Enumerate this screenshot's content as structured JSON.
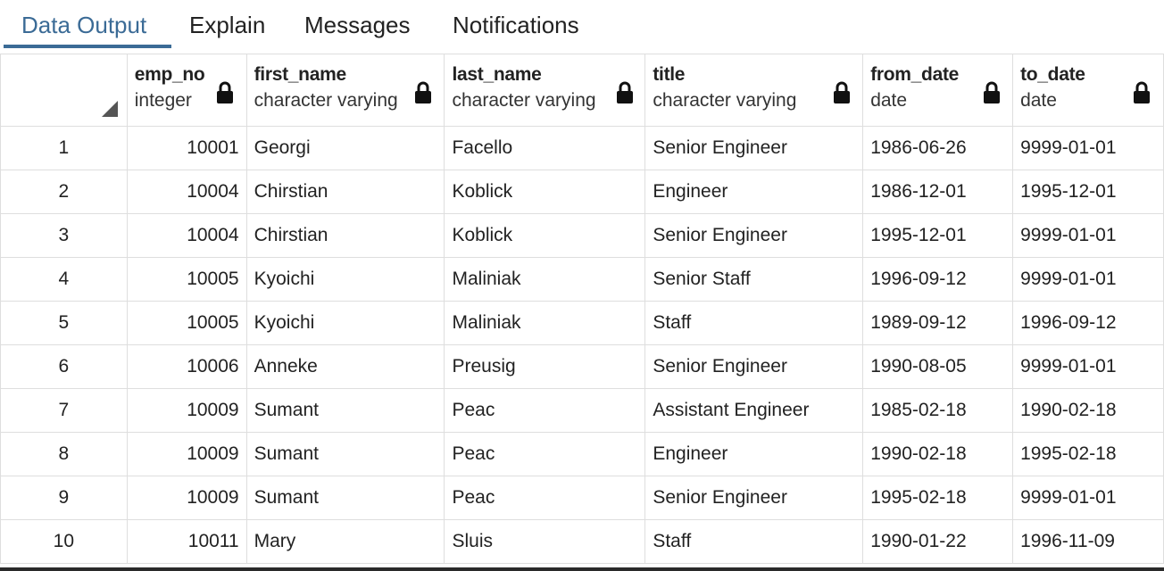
{
  "tabs": [
    {
      "label": "Data Output",
      "active": true
    },
    {
      "label": "Explain",
      "active": false
    },
    {
      "label": "Messages",
      "active": false
    },
    {
      "label": "Notifications",
      "active": false
    }
  ],
  "grid": {
    "columns": [
      {
        "name": "emp_no",
        "type": "integer",
        "icon": "lock-icon"
      },
      {
        "name": "first_name",
        "type": "character varying",
        "icon": "lock-icon"
      },
      {
        "name": "last_name",
        "type": "character varying",
        "icon": "lock-icon"
      },
      {
        "name": "title",
        "type": "character varying",
        "icon": "lock-icon"
      },
      {
        "name": "from_date",
        "type": "date",
        "icon": "lock-icon"
      },
      {
        "name": "to_date",
        "type": "date",
        "icon": "lock-icon"
      }
    ],
    "rows": [
      [
        "1",
        "10001",
        "Georgi",
        "Facello",
        "Senior Engineer",
        "1986-06-26",
        "9999-01-01"
      ],
      [
        "2",
        "10004",
        "Chirstian",
        "Koblick",
        "Engineer",
        "1986-12-01",
        "1995-12-01"
      ],
      [
        "3",
        "10004",
        "Chirstian",
        "Koblick",
        "Senior Engineer",
        "1995-12-01",
        "9999-01-01"
      ],
      [
        "4",
        "10005",
        "Kyoichi",
        "Maliniak",
        "Senior Staff",
        "1996-09-12",
        "9999-01-01"
      ],
      [
        "5",
        "10005",
        "Kyoichi",
        "Maliniak",
        "Staff",
        "1989-09-12",
        "1996-09-12"
      ],
      [
        "6",
        "10006",
        "Anneke",
        "Preusig",
        "Senior Engineer",
        "1990-08-05",
        "9999-01-01"
      ],
      [
        "7",
        "10009",
        "Sumant",
        "Peac",
        "Assistant Engineer",
        "1985-02-18",
        "1990-02-18"
      ],
      [
        "8",
        "10009",
        "Sumant",
        "Peac",
        "Engineer",
        "1990-02-18",
        "1995-02-18"
      ],
      [
        "9",
        "10009",
        "Sumant",
        "Peac",
        "Senior Engineer",
        "1995-02-18",
        "9999-01-01"
      ],
      [
        "10",
        "10011",
        "Mary",
        "Sluis",
        "Staff",
        "1990-01-22",
        "1996-11-09"
      ]
    ]
  },
  "colors": {
    "accent": "#3b6b96",
    "border": "#dedede",
    "text": "#222222"
  }
}
